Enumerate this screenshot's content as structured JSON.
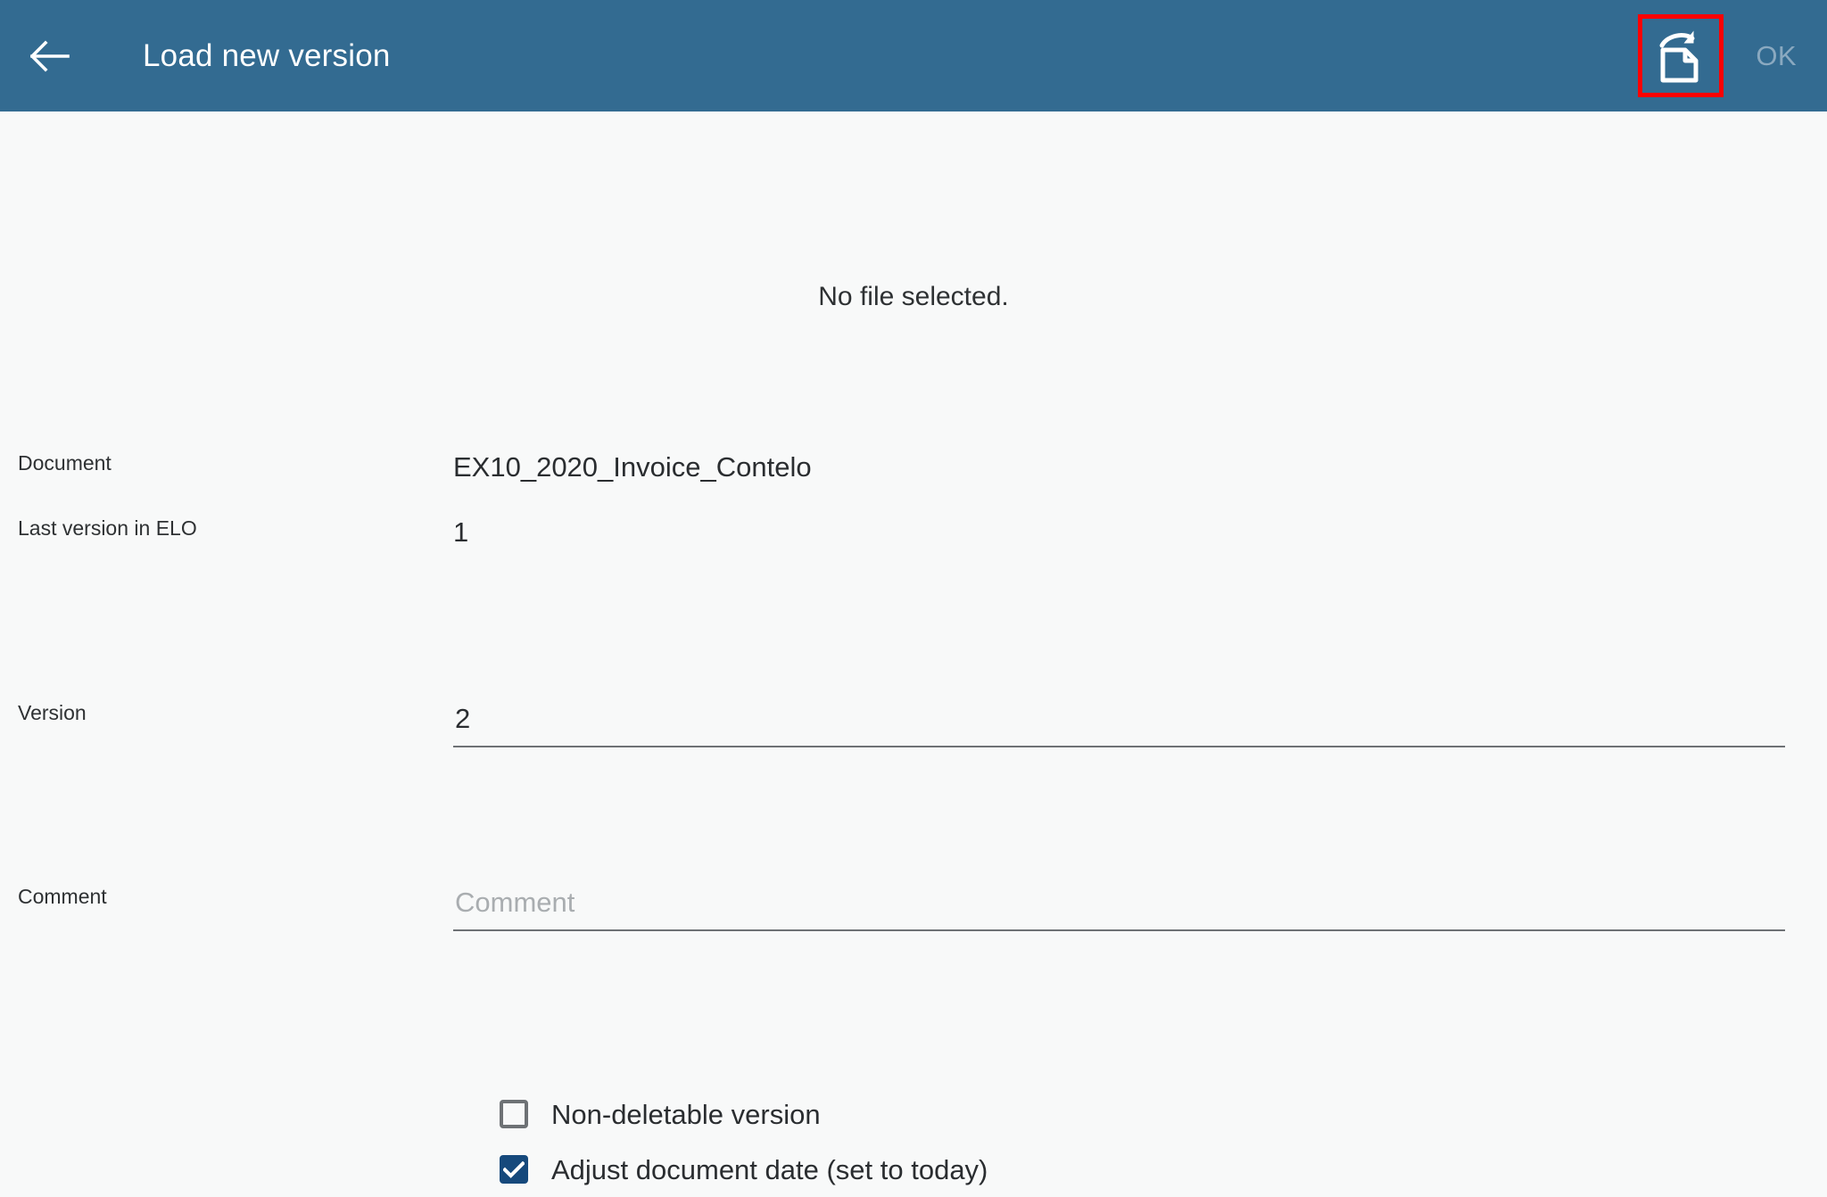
{
  "appbar": {
    "back_icon": "arrow-left-icon",
    "title": "Load new version",
    "upload_icon": "document-upload-new-version-icon",
    "ok_label": "OK",
    "bar_color": "#336b91",
    "title_color": "#ffffff",
    "ok_color": "#8aa9c0",
    "highlight_color": "#ff0000"
  },
  "content": {
    "status": "No file selected.",
    "background_color": "#f8f9f9"
  },
  "form": {
    "rows": [
      {
        "label": "Document",
        "value": "EX10_2020_Invoice_Contelo",
        "type": "readonly"
      },
      {
        "label": "Last version in ELO",
        "value": "1",
        "type": "readonly"
      },
      {
        "label": "Version",
        "value": "2",
        "placeholder": "",
        "type": "input"
      },
      {
        "label": "Comment",
        "value": "",
        "placeholder": "Comment",
        "type": "input"
      }
    ]
  },
  "checkboxes": [
    {
      "label": "Non-deletable version",
      "checked": false
    },
    {
      "label": "Adjust document date (set to today)",
      "checked": true
    }
  ],
  "colors": {
    "checkbox_checked": "#16497c",
    "checkbox_unchecked_border": "#6e7275",
    "field_underline": "#6e7275",
    "placeholder_text": "#a9adb0",
    "body_text": "#2a2d30",
    "label_text": "#2e3133"
  }
}
